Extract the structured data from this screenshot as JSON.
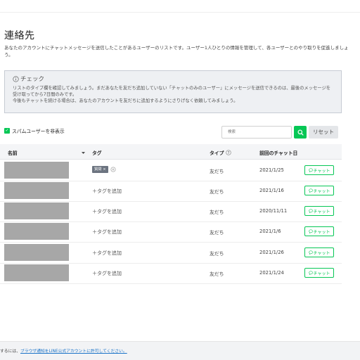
{
  "page": {
    "title": "連絡先",
    "description": "あなたのアカウントにチャットメッセージを送信したことがあるユーザーのリストです。ユーザー1人ひとりの情報を管理して、各ユーザーとのやり取りを促進しましょう。"
  },
  "check": {
    "title": "チェック",
    "text": "リストのタイプ欄を確認してみましょう。まだあなたを友だち追加していない「チャットのみのユーザー」にメッセージを送信できるのは、最後のメッセージを受け取ってから7日間のみです。",
    "text2": "今後もチャットを続ける場合は、あなたのアカウントを友だちに追加するようにさりげなく依頼してみましょう。"
  },
  "filters": {
    "hide_spam_label": "スパムユーザーを非表示",
    "search_placeholder": "検索",
    "reset_label": "リセット"
  },
  "table": {
    "headers": {
      "name": "名前",
      "tag": "タグ",
      "type": "タイプ",
      "last_chat": "前回のチャット日"
    },
    "rows": [
      {
        "tag": "質問",
        "add_tag": "",
        "type": "友だち",
        "date": "2021/1/25",
        "chat": "チャット"
      },
      {
        "tag": "",
        "add_tag": "＋タグを追加",
        "type": "友だち",
        "date": "2021/1/16",
        "chat": "チャット"
      },
      {
        "tag": "",
        "add_tag": "＋タグを追加",
        "type": "友だち",
        "date": "2020/11/11",
        "chat": "チャット"
      },
      {
        "tag": "",
        "add_tag": "＋タグを追加",
        "type": "友だち",
        "date": "2021/1/6",
        "chat": "チャット"
      },
      {
        "tag": "",
        "add_tag": "＋タグを追加",
        "type": "友だち",
        "date": "2021/1/26",
        "chat": "チャット"
      },
      {
        "tag": "",
        "add_tag": "＋タグを追加",
        "type": "友だち",
        "date": "2021/1/24",
        "chat": "チャット"
      }
    ]
  },
  "footer": {
    "prefix": "するには、",
    "link": "ブラウザ通知をLINE公式アカウントに許可してください。"
  },
  "colors": {
    "accent": "#06c755",
    "tag_chip": "#6c7480",
    "avatar_placeholder": "#a7a7a7"
  },
  "icons": {
    "info": "info-circle-icon",
    "checkbox": "checkbox-checked-icon",
    "search": "search-icon",
    "sort": "sort-arrow-icon",
    "help": "help-circle-icon",
    "chat": "chat-bubble-icon",
    "chip_remove": "close-icon",
    "add_tag": "plus-circle-icon"
  }
}
